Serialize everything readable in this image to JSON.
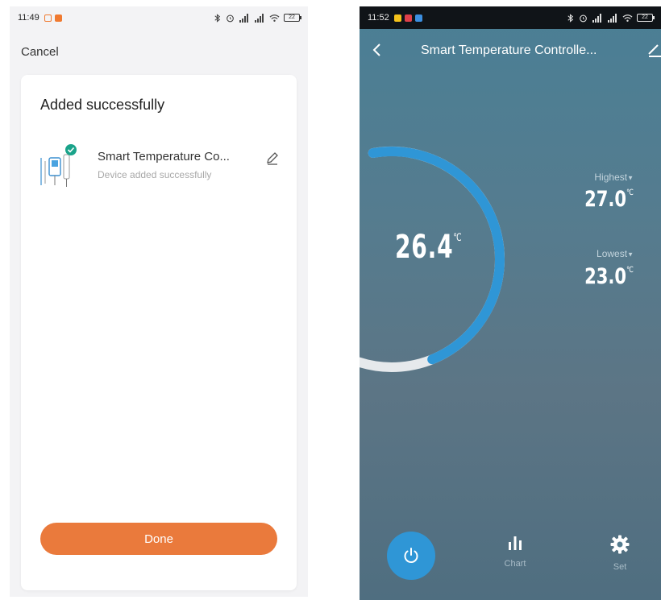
{
  "left_screen": {
    "status_bar": {
      "time": "11:49",
      "battery": "22"
    },
    "cancel_label": "Cancel",
    "card_title": "Added successfully",
    "device": {
      "name": "Smart Temperature Co...",
      "status": "Device added successfully"
    },
    "done_label": "Done"
  },
  "right_screen": {
    "status_bar": {
      "time": "11:52",
      "battery": "22"
    },
    "title": "Smart Temperature Controlle...",
    "current_temp": "26.4",
    "temp_unit": "℃",
    "gauge_fraction": 0.8,
    "highest": {
      "label": "Highest",
      "value": "27.0",
      "unit": "℃"
    },
    "lowest": {
      "label": "Lowest",
      "value": "23.0",
      "unit": "℃"
    },
    "nav": {
      "chart_label": "Chart",
      "set_label": "Set"
    }
  },
  "colors": {
    "accent_orange": "#ea7a3c",
    "gauge_blue": "#2f96d6",
    "check_teal": "#1aa38a",
    "background_teal": "#557c8f"
  },
  "icons": [
    "check-icon",
    "edit-icon",
    "back-icon",
    "power-icon",
    "chart-icon",
    "gear-icon",
    "wifi-icon",
    "signal-icon",
    "battery-icon",
    "alarm-icon",
    "bluetooth-icon"
  ]
}
